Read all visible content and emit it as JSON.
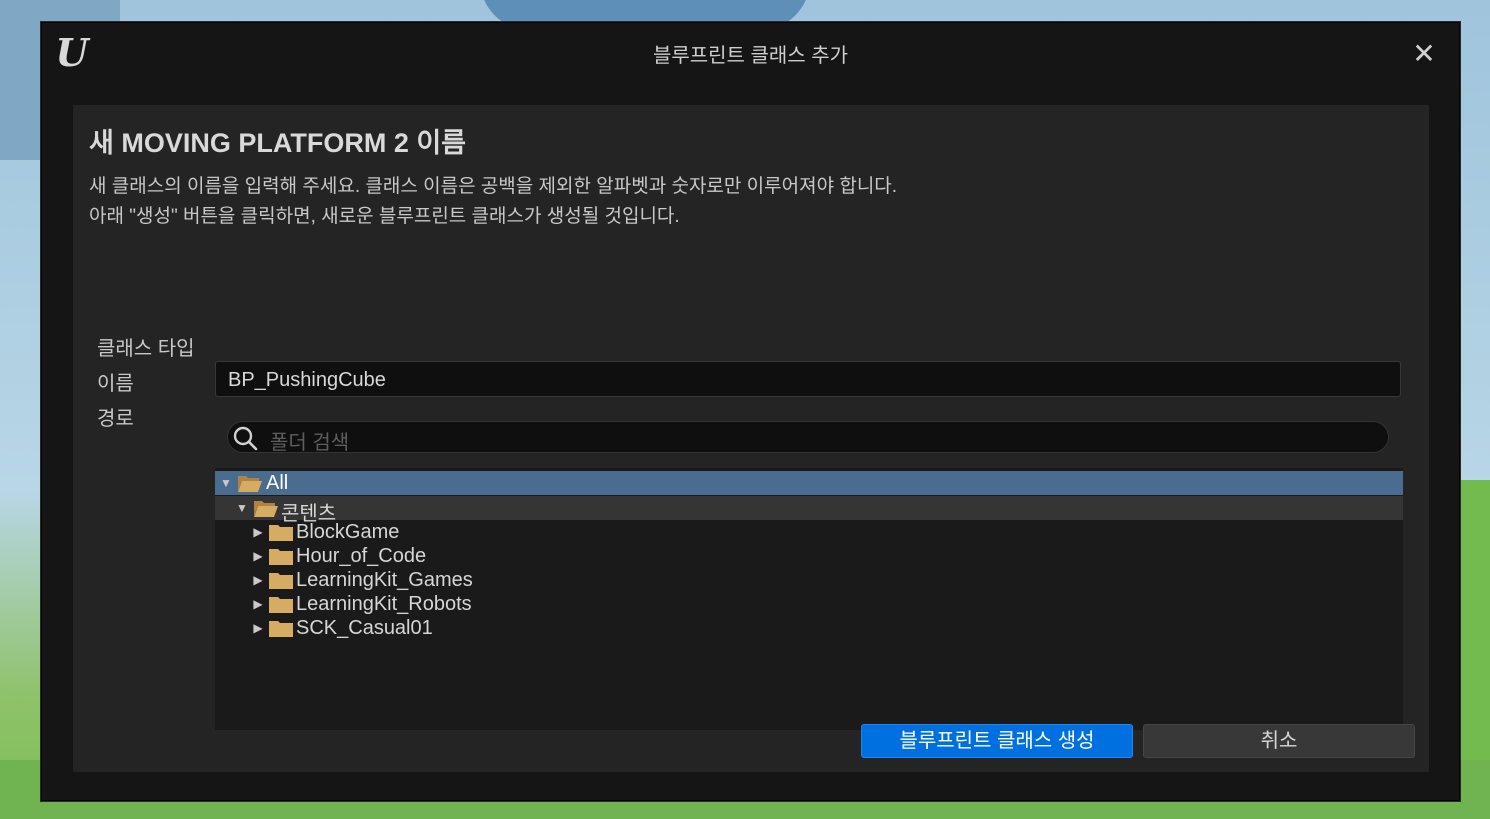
{
  "window": {
    "title": "블루프린트 클래스 추가",
    "logo": "U",
    "close_glyph": "✕"
  },
  "panel": {
    "heading": "새 MOVING PLATFORM 2 이름",
    "description_line1": "새 클래스의 이름을 입력해 주세요. 클래스 이름은 공백을 제외한 알파벳과 숫자로만 이루어져야 합니다.",
    "description_line2": "아래 \"생성\" 버튼을 클릭하면, 새로운 블루프린트 클래스가 생성될 것입니다."
  },
  "form": {
    "class_type_label": "클래스 타입",
    "name_label": "이름",
    "path_label": "경로",
    "name_value": "BP_PushingCube",
    "search_placeholder": "폴더 검색"
  },
  "tree": {
    "root": {
      "label": "All",
      "expanded": true,
      "selected": true
    },
    "content": {
      "label": "콘텐츠",
      "expanded": true
    },
    "children": [
      {
        "label": "BlockGame"
      },
      {
        "label": "Hour_of_Code"
      },
      {
        "label": "LearningKit_Games"
      },
      {
        "label": "LearningKit_Robots"
      },
      {
        "label": "SCK_Casual01"
      }
    ]
  },
  "buttons": {
    "create_label": "블루프린트 클래스 생성",
    "cancel_label": "취소"
  },
  "colors": {
    "accent": "#0070e0",
    "selection": "#4a6d8f",
    "folder": "#c8a05a"
  }
}
